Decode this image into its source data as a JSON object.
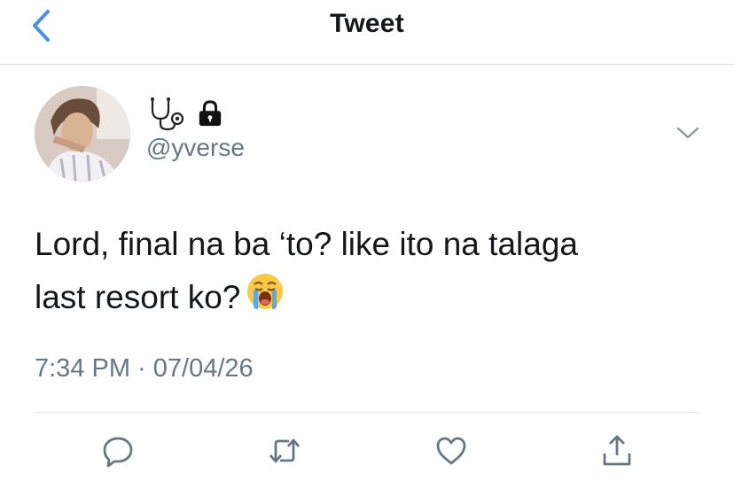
{
  "header": {
    "title": "Tweet"
  },
  "user": {
    "display_name_emoji": "🩺",
    "protected": true,
    "handle": "@yverse"
  },
  "tweet": {
    "text_line1": "Lord, final na ba ‘to? like ito na talaga",
    "text_line2": "last resort ko?",
    "emoji": "😭",
    "timestamp": "7:34 PM · 07/04/26"
  },
  "colors": {
    "accent": "#4a90e2",
    "text": "#14171a",
    "muted": "#657786",
    "divider": "#e1e6ea"
  },
  "icons": [
    "back-chevron-icon",
    "stethoscope-icon",
    "lock-icon",
    "chevron-down-icon",
    "reply-icon",
    "retweet-icon",
    "like-icon",
    "share-icon"
  ]
}
